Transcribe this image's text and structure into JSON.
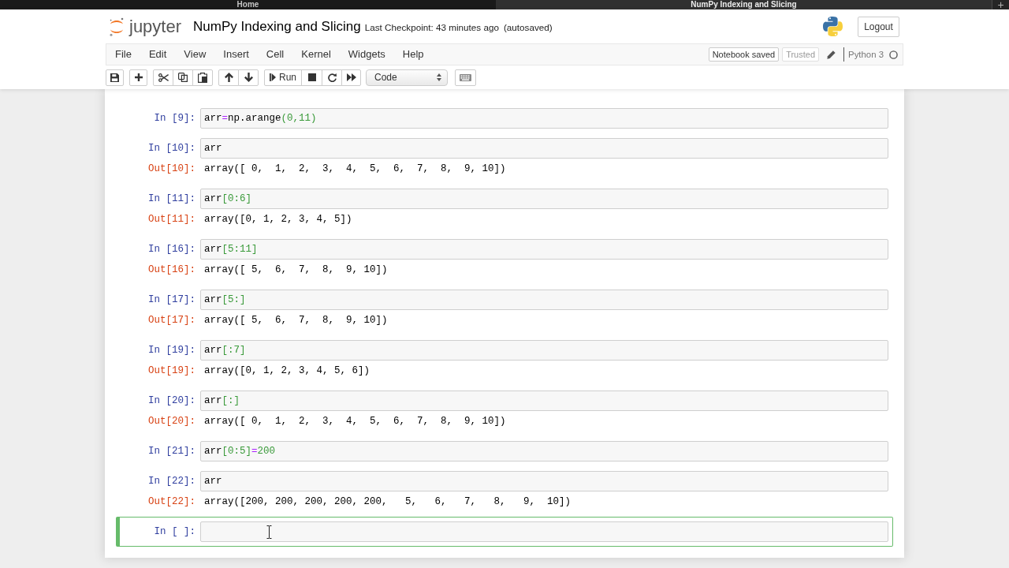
{
  "browser_tabs": [
    {
      "label": "Home",
      "selected": false
    },
    {
      "label": "NumPy Indexing and Slicing",
      "selected": true
    }
  ],
  "new_tab": "+",
  "header": {
    "logo_text": "jupyter",
    "notebook_title": "NumPy Indexing and Slicing",
    "checkpoint": "Last Checkpoint: 43 minutes ago",
    "autosave": "(autosaved)",
    "logout": "Logout"
  },
  "menu": {
    "items": [
      "File",
      "Edit",
      "View",
      "Insert",
      "Cell",
      "Kernel",
      "Widgets",
      "Help"
    ],
    "notification": "Notebook saved",
    "trusted": "Trusted",
    "kernel_name": "Python 3",
    "kernel_busy": false
  },
  "toolbar": {
    "run_label": "Run",
    "cell_type": "Code"
  },
  "cells": [
    {
      "prompt": "In [9]:",
      "code": [
        {
          "text": "arr",
          "kind": "plain"
        },
        {
          "text": "=",
          "kind": "operator"
        },
        {
          "text": "np.arange",
          "kind": "plain"
        },
        {
          "text": "(0,11)",
          "kind": "literal"
        }
      ],
      "selected": false
    },
    {
      "prompt": "In [10]:",
      "code": [
        {
          "text": "arr",
          "kind": "plain"
        }
      ],
      "output": {
        "prompt": "Out[10]:",
        "text": "array([ 0,  1,  2,  3,  4,  5,  6,  7,  8,  9, 10])"
      },
      "selected": false
    },
    {
      "prompt": "In [11]:",
      "code": [
        {
          "text": "arr",
          "kind": "plain"
        },
        {
          "text": "[0:6]",
          "kind": "literal"
        }
      ],
      "output": {
        "prompt": "Out[11]:",
        "text": "array([0, 1, 2, 3, 4, 5])"
      },
      "selected": false
    },
    {
      "prompt": "In [16]:",
      "code": [
        {
          "text": "arr",
          "kind": "plain"
        },
        {
          "text": "[5:11]",
          "kind": "literal"
        }
      ],
      "output": {
        "prompt": "Out[16]:",
        "text": "array([ 5,  6,  7,  8,  9, 10])"
      },
      "selected": false
    },
    {
      "prompt": "In [17]:",
      "code": [
        {
          "text": "arr",
          "kind": "plain"
        },
        {
          "text": "[5:]",
          "kind": "literal"
        }
      ],
      "output": {
        "prompt": "Out[17]:",
        "text": "array([ 5,  6,  7,  8,  9, 10])"
      },
      "selected": false
    },
    {
      "prompt": "In [19]:",
      "code": [
        {
          "text": "arr",
          "kind": "plain"
        },
        {
          "text": "[:7]",
          "kind": "literal"
        }
      ],
      "output": {
        "prompt": "Out[19]:",
        "text": "array([0, 1, 2, 3, 4, 5, 6])"
      },
      "selected": false
    },
    {
      "prompt": "In [20]:",
      "code": [
        {
          "text": "arr",
          "kind": "plain"
        },
        {
          "text": "[:]",
          "kind": "literal"
        }
      ],
      "output": {
        "prompt": "Out[20]:",
        "text": "array([ 0,  1,  2,  3,  4,  5,  6,  7,  8,  9, 10])"
      },
      "selected": false
    },
    {
      "prompt": "In [21]:",
      "code": [
        {
          "text": "arr",
          "kind": "plain"
        },
        {
          "text": "[0:5]",
          "kind": "literal"
        },
        {
          "text": "=",
          "kind": "operator"
        },
        {
          "text": "200",
          "kind": "literal"
        }
      ],
      "selected": false
    },
    {
      "prompt": "In [22]:",
      "code": [
        {
          "text": "arr",
          "kind": "plain"
        }
      ],
      "output": {
        "prompt": "Out[22]:",
        "text": "array([200, 200, 200, 200, 200,   5,   6,   7,   8,   9,  10])"
      },
      "selected": false
    },
    {
      "prompt": "In [ ]:",
      "selected": true
    }
  ]
}
